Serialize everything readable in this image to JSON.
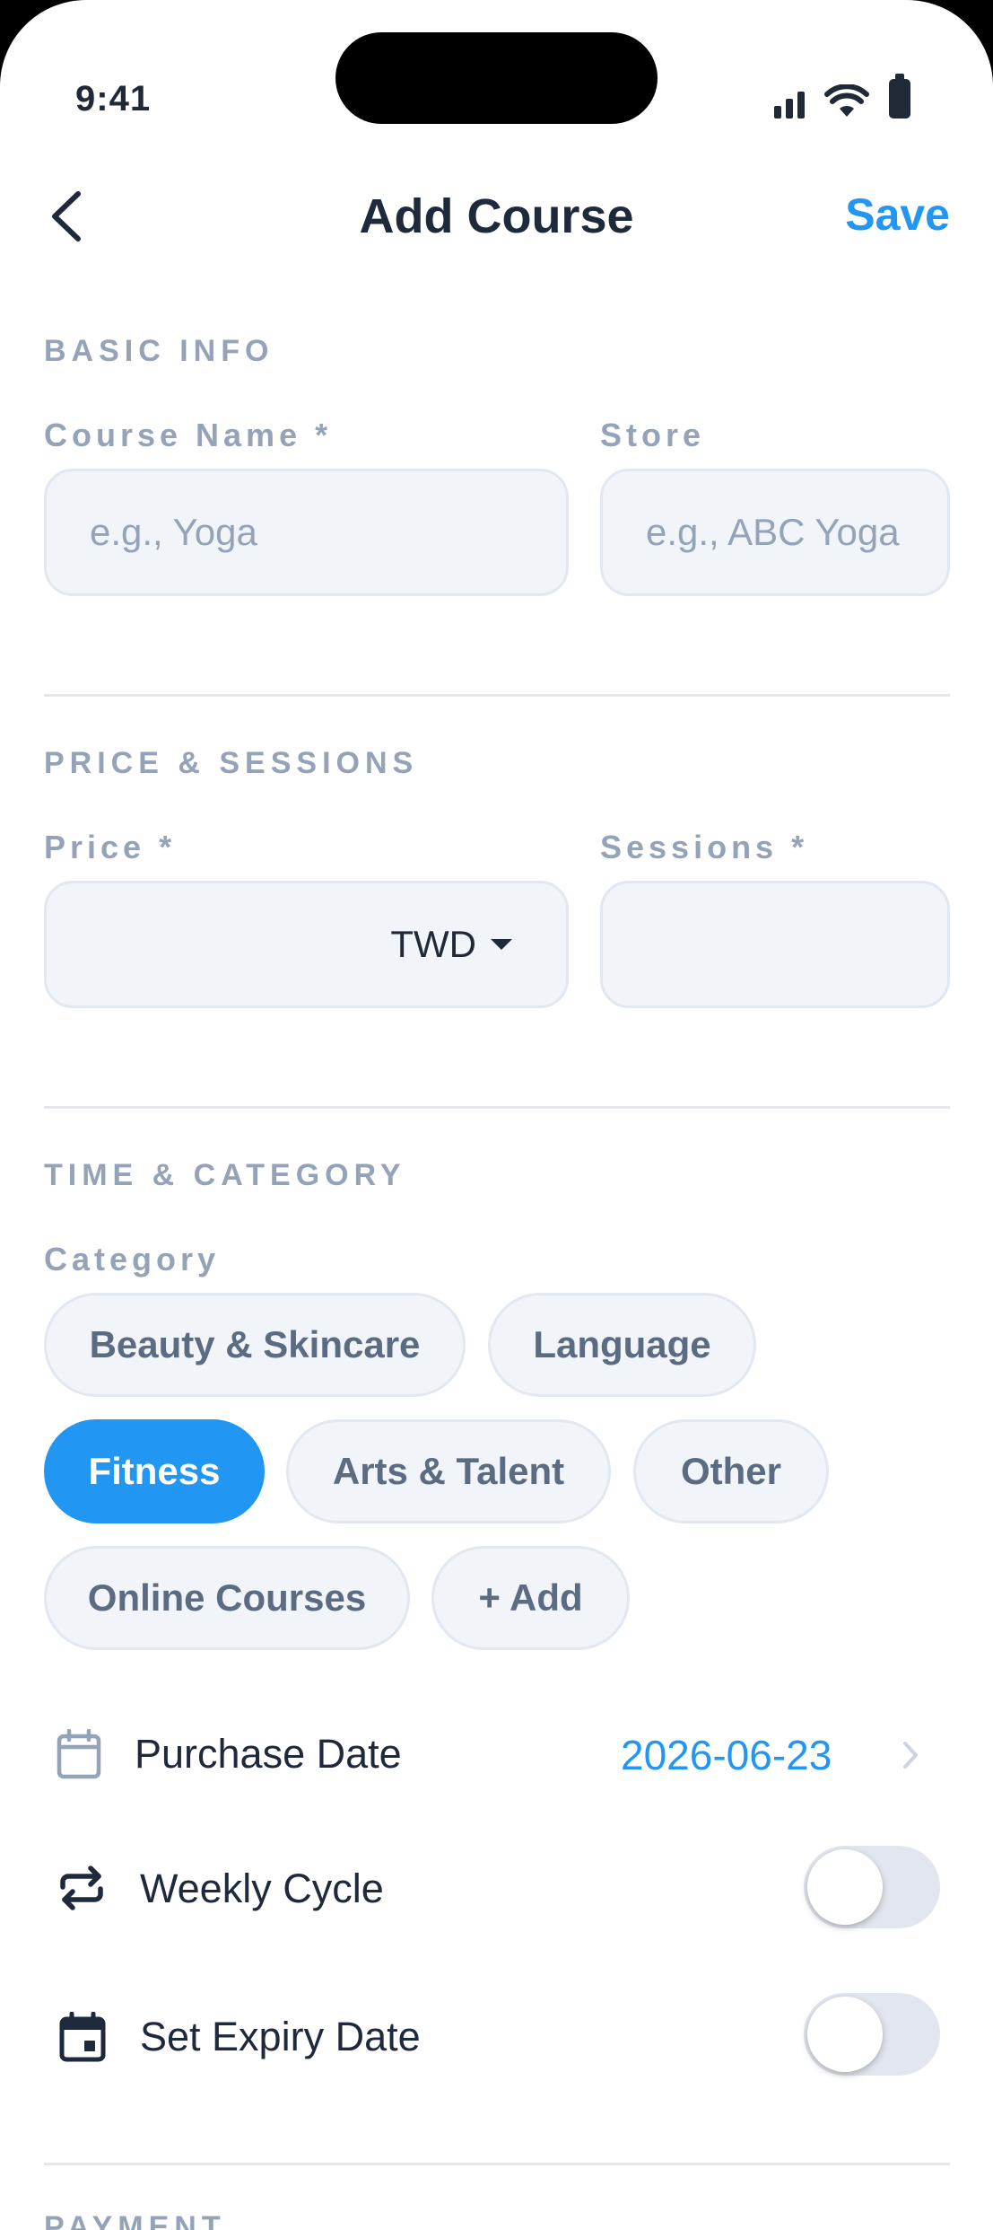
{
  "status_bar": {
    "time": "9:41"
  },
  "nav": {
    "title": "Add Course",
    "save_label": "Save"
  },
  "basic_info": {
    "section_title": "BASIC INFO",
    "course_name_label": "Course Name *",
    "course_name_placeholder": "e.g., Yoga",
    "store_label": "Store",
    "store_placeholder": "e.g., ABC Yoga"
  },
  "price_sessions": {
    "section_title": "PRICE & SESSIONS",
    "price_label": "Price *",
    "currency": "TWD",
    "sessions_label": "Sessions *"
  },
  "time_category": {
    "section_title": "TIME & CATEGORY",
    "category_label": "Category",
    "categories": [
      "Beauty & Skincare",
      "Language",
      "Fitness",
      "Arts & Talent",
      "Other",
      "Online Courses",
      "+ Add"
    ],
    "selected_category": "Fitness",
    "purchase_date_label": "Purchase Date",
    "purchase_date_value": "2026-06-23",
    "weekly_cycle_label": "Weekly Cycle",
    "weekly_cycle_enabled": false,
    "set_expiry_label": "Set Expiry Date",
    "set_expiry_enabled": false
  },
  "payment": {
    "section_title": "PAYMENT"
  },
  "colors": {
    "accent": "#2196f3",
    "title": "#1e293b",
    "muted": "#94a3b8",
    "field_bg": "#f1f4f9"
  }
}
